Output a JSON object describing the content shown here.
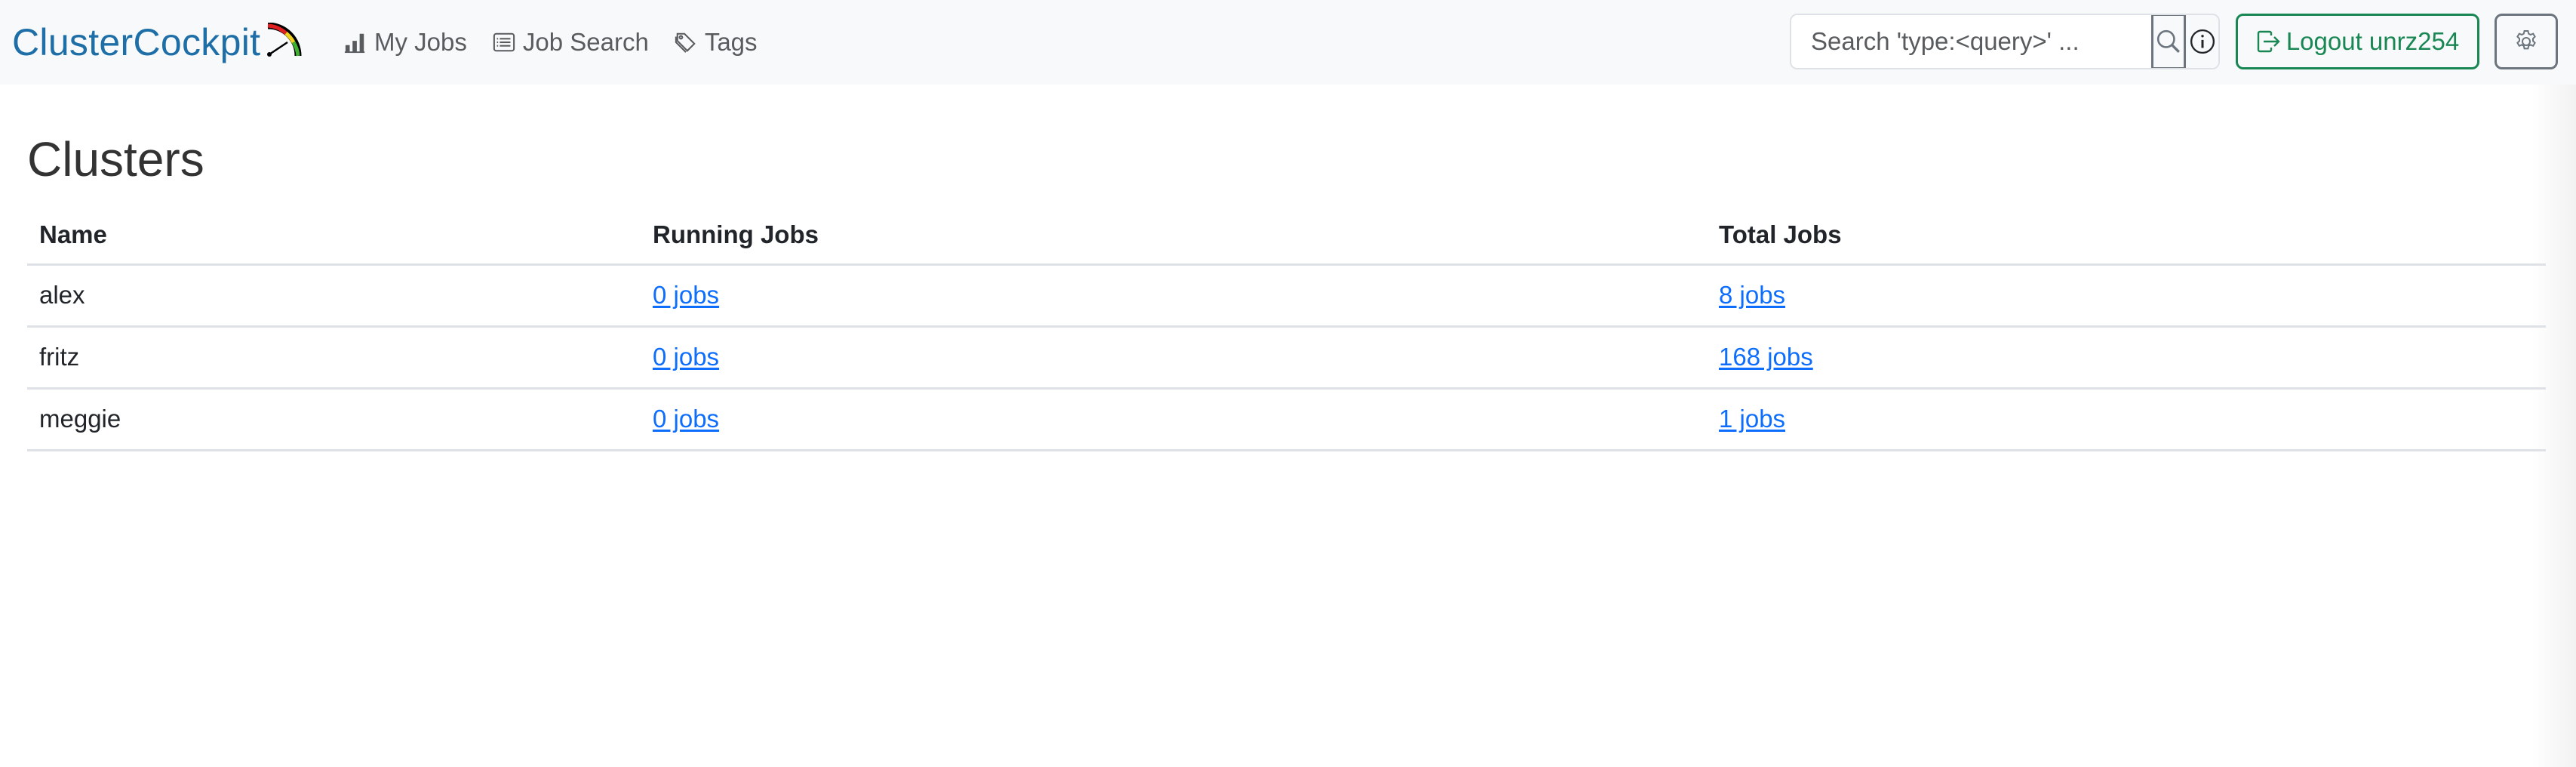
{
  "navbar": {
    "brand": "ClusterCockpit",
    "brand_logo_icon": "gauge-icon",
    "items": [
      {
        "label": "My Jobs",
        "icon": "bar-chart-icon"
      },
      {
        "label": "Job Search",
        "icon": "list-icon"
      },
      {
        "label": "Tags",
        "icon": "tags-icon"
      }
    ],
    "search": {
      "placeholder": "Search 'type:<query>' ...",
      "value": "",
      "search_icon": "search-icon",
      "info_icon": "info-icon"
    },
    "logout_label": "Logout unrz254",
    "logout_icon": "box-arrow-right-icon",
    "settings_icon": "gear-icon"
  },
  "page": {
    "title": "Clusters"
  },
  "table": {
    "columns": [
      "Name",
      "Running Jobs",
      "Total Jobs"
    ],
    "rows": [
      {
        "name": "alex",
        "running": "0 jobs",
        "total": "8 jobs"
      },
      {
        "name": "fritz",
        "running": "0 jobs",
        "total": "168 jobs"
      },
      {
        "name": "meggie",
        "running": "0 jobs",
        "total": "1 jobs"
      }
    ]
  },
  "colors": {
    "brand": "#1e6ea7",
    "navbar_bg": "#f8f9fa",
    "link": "#0d6efd",
    "logout": "#198754",
    "muted": "#6c757d"
  }
}
